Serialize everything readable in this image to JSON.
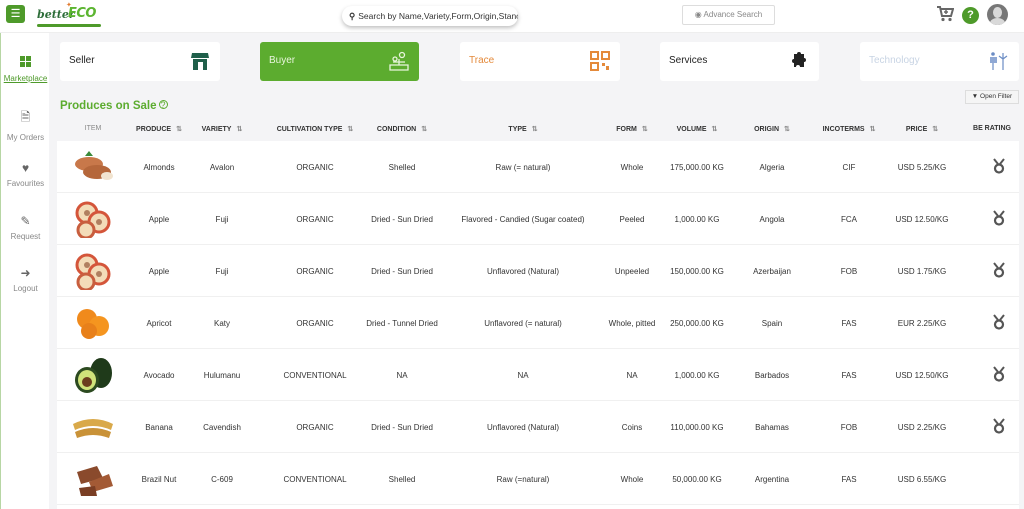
{
  "header": {
    "menu_icon": "hamburger-icon",
    "logo": {
      "better": "better",
      "eco": "ECO"
    },
    "search_placeholder": "Search by Name,Variety,Form,Origin,Stanc",
    "advance_search_label": "Advance Search",
    "icons": [
      "cart-icon",
      "help-icon",
      "avatar"
    ]
  },
  "sidebar": {
    "items": [
      {
        "label": "Marketplace",
        "icon": "grid-icon",
        "active": true
      },
      {
        "label": "My Orders",
        "icon": "document-icon",
        "active": false
      },
      {
        "label": "Favourites",
        "icon": "heart-icon",
        "active": false
      },
      {
        "label": "Request",
        "icon": "edit-icon",
        "active": false
      },
      {
        "label": "Logout",
        "icon": "logout-icon",
        "active": false
      }
    ]
  },
  "categories": [
    {
      "label": "Seller",
      "icon": "store-icon",
      "active": false
    },
    {
      "label": "Buyer",
      "icon": "buyer-icon",
      "active": true
    },
    {
      "label": "Trace",
      "icon": "qr-code-icon",
      "active": false
    },
    {
      "label": "Services",
      "icon": "puzzle-icon",
      "active": false
    },
    {
      "label": "Technology",
      "icon": "solar-wind-icon",
      "active": false
    }
  ],
  "open_filter_label": "Open Filter",
  "section_title": "Produces on Sale",
  "table": {
    "columns": [
      "ITEM",
      "PRODUCE",
      "VARIETY",
      "CULTIVATION TYPE",
      "CONDITION",
      "TYPE",
      "FORM",
      "VOLUME",
      "ORIGIN",
      "INCOTERMS",
      "PRICE",
      "BE RATING"
    ],
    "rows": [
      {
        "item": "almonds",
        "produce": "Almonds",
        "variety": "Avalon",
        "cultivation": "ORGANIC",
        "condition": "Shelled",
        "type": "Raw (= natural)",
        "form": "Whole",
        "volume": "175,000.00 KG",
        "origin": "Algeria",
        "incoterms": "CIF",
        "price": "USD 5.25/KG",
        "rating": true
      },
      {
        "item": "apple",
        "produce": "Apple",
        "variety": "Fuji",
        "cultivation": "ORGANIC",
        "condition": "Dried - Sun Dried",
        "type": "Flavored - Candied (Sugar coated)",
        "form": "Peeled",
        "volume": "1,000.00 KG",
        "origin": "Angola",
        "incoterms": "FCA",
        "price": "USD 12.50/KG",
        "rating": true
      },
      {
        "item": "apple",
        "produce": "Apple",
        "variety": "Fuji",
        "cultivation": "ORGANIC",
        "condition": "Dried - Sun Dried",
        "type": "Unflavored (Natural)",
        "form": "Unpeeled",
        "volume": "150,000.00 KG",
        "origin": "Azerbaijan",
        "incoterms": "FOB",
        "price": "USD 1.75/KG",
        "rating": true
      },
      {
        "item": "apricot",
        "produce": "Apricot",
        "variety": "Katy",
        "cultivation": "ORGANIC",
        "condition": "Dried - Tunnel Dried",
        "type": "Unflavored (= natural)",
        "form": "Whole, pitted",
        "volume": "250,000.00 KG",
        "origin": "Spain",
        "incoterms": "FAS",
        "price": "EUR 2.25/KG",
        "rating": true
      },
      {
        "item": "avocado",
        "produce": "Avocado",
        "variety": "Hulumanu",
        "cultivation": "CONVENTIONAL",
        "condition": "NA",
        "type": "NA",
        "form": "NA",
        "volume": "1,000.00 KG",
        "origin": "Barbados",
        "incoterms": "FAS",
        "price": "USD 12.50/KG",
        "rating": true
      },
      {
        "item": "banana",
        "produce": "Banana",
        "variety": "Cavendish",
        "cultivation": "ORGANIC",
        "condition": "Dried - Sun Dried",
        "type": "Unflavored (Natural)",
        "form": "Coins",
        "volume": "110,000.00 KG",
        "origin": "Bahamas",
        "incoterms": "FOB",
        "price": "USD 2.25/KG",
        "rating": true
      },
      {
        "item": "brazil-nut",
        "produce": "Brazil Nut",
        "variety": "C-609",
        "cultivation": "CONVENTIONAL",
        "condition": "Shelled",
        "type": "Raw (=natural)",
        "form": "Whole",
        "volume": "50,000.00 KG",
        "origin": "Argentina",
        "incoterms": "FAS",
        "price": "USD 6.55/KG",
        "rating": false
      }
    ]
  },
  "colors": {
    "brand_green": "#5cac2f",
    "dark_green": "#4e9a2a",
    "trace_orange": "#e48a3b",
    "seller_icon": "#1f5f4a"
  }
}
